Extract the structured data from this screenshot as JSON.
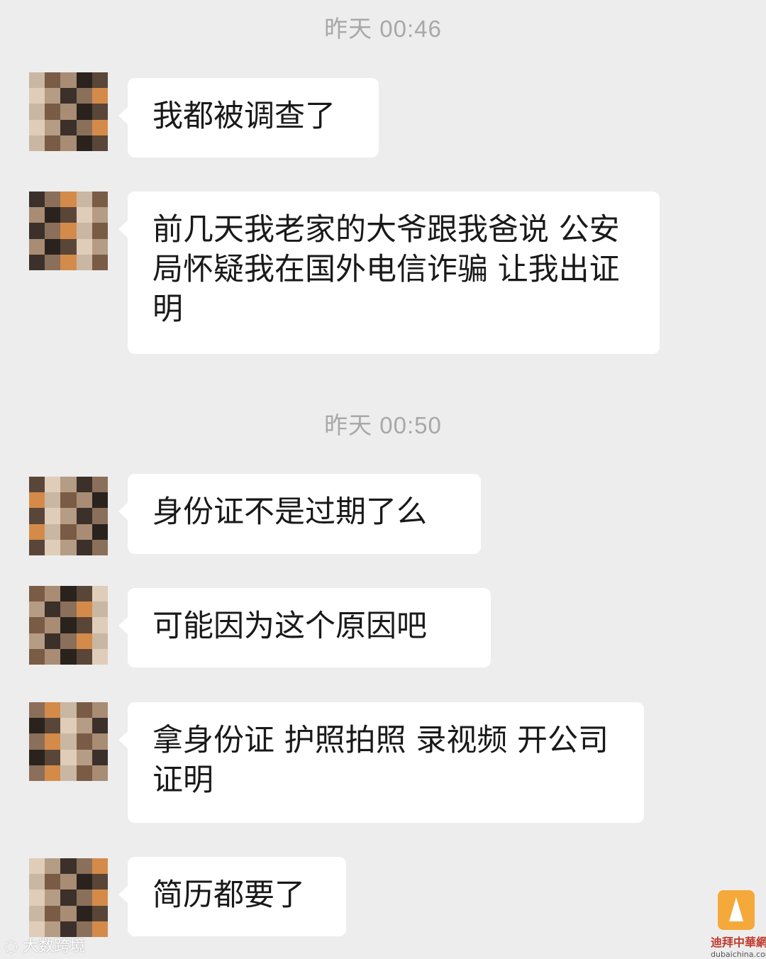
{
  "timestamps": [
    "昨天 00:46",
    "昨天 00:50"
  ],
  "messages": [
    {
      "text": "我都被调查了"
    },
    {
      "text": "前几天我老家的大爷跟我爸说 公安局怀疑我在国外电信诈骗 让我出证明"
    },
    {
      "text": "身份证不是过期了么"
    },
    {
      "text": "可能因为这个原因吧"
    },
    {
      "text": "拿身份证 护照拍照 录视频 开公司证明"
    },
    {
      "text": "简历都要了"
    }
  ],
  "watermarks": {
    "left": "大数跨境",
    "right_cn": "迪拜中華網",
    "right_en": "dubaichina.com"
  },
  "avatar_palette": [
    "#c9b7a3",
    "#d48b4a",
    "#8a6f5a",
    "#3b302a",
    "#b59c85",
    "#e0cdb9",
    "#5a4638",
    "#2a221d",
    "#a88c74",
    "#7a5c46"
  ]
}
